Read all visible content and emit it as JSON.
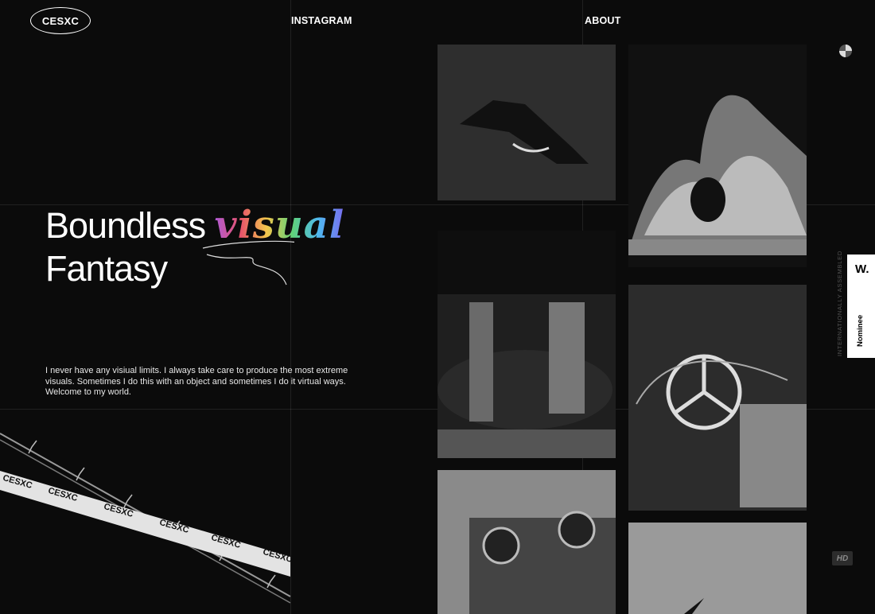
{
  "header": {
    "logo": "CESXC",
    "nav": [
      "INSTAGRAM",
      "ABOUT"
    ]
  },
  "hero": {
    "title_word1": "Boundless",
    "title_word2": "visual",
    "title_line2": "Fantasy",
    "description": "I never have any visiual limits. I always take care to produce the most extreme visuals. Sometimes I do this with an object and sometimes I do it virtual ways. Welcome to my world."
  },
  "tape": {
    "label": "CESXC"
  },
  "sidebar": {
    "vertical_text": "INTERNATIONALLY ASSEMBLED",
    "award_logo": "W.",
    "award_label": "Nominee",
    "hd_badge": "HD"
  },
  "colors": {
    "background": "#0b0b0b",
    "text": "#ffffff",
    "award_bg": "#ffffff"
  },
  "gallery": {
    "photos": [
      "car-drift-photo",
      "fire-jump-photo",
      "two-men-car-photo",
      "mercedes-barbed-wire-photo",
      "camera-lens-photo",
      "dark-figure-photo"
    ]
  }
}
